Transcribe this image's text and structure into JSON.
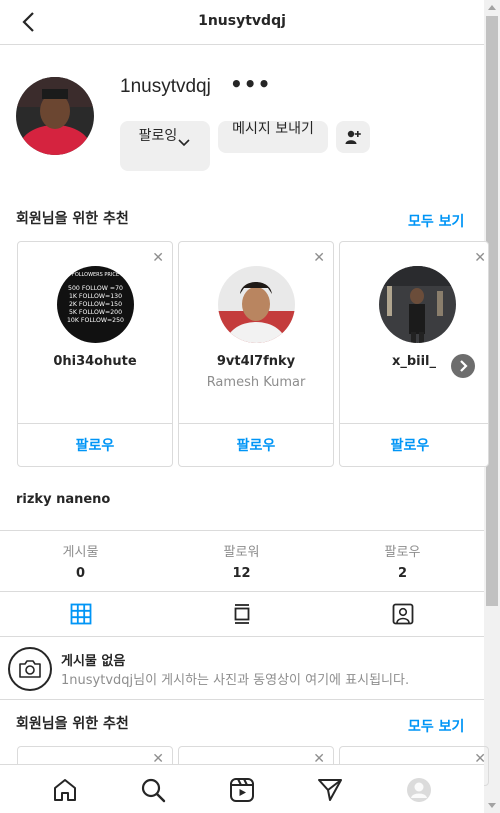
{
  "header": {
    "title": "1nusytvdqj"
  },
  "profile": {
    "username": "1nusytvdqj",
    "more": "•••",
    "following_label": "팔로잉",
    "message_label": "메시지 보내기",
    "full_name": "rizky naneno"
  },
  "suggestions": {
    "title": "회원님을 위한 추천",
    "see_all": "모두 보기",
    "cards": [
      {
        "username": "0hi34ohute",
        "subtitle": "",
        "follow": "팔로우",
        "avatar_lines": [
          "FOLLOWERS PRICE",
          "500 FOLLOW =70",
          "1K FOLLOW=130",
          "2K FOLLOW=150",
          "5K FOLLOW=200",
          "10K FOLLOW=250"
        ]
      },
      {
        "username": "9vt4l7fnky",
        "subtitle": "Ramesh Kumar",
        "follow": "팔로우"
      },
      {
        "username": "x_biil_",
        "subtitle": "",
        "follow": "팔로우"
      }
    ]
  },
  "stats": [
    {
      "label": "게시물",
      "value": "0"
    },
    {
      "label": "팔로워",
      "value": "12"
    },
    {
      "label": "팔로우",
      "value": "2"
    }
  ],
  "empty": {
    "title": "게시물 없음",
    "description": "1nusytvdqj님이 게시하는 사진과 동영상이 여기에 표시됩니다."
  },
  "suggestions2": {
    "title": "회원님을 위한 추천",
    "see_all": "모두 보기"
  },
  "nav": [
    "home-icon",
    "search-icon",
    "reels-icon",
    "direct-icon",
    "profile-avatar"
  ],
  "colors": {
    "accent": "#0095f6",
    "text": "#262626",
    "muted": "#8e8e8e",
    "border": "#dbdbdb"
  }
}
